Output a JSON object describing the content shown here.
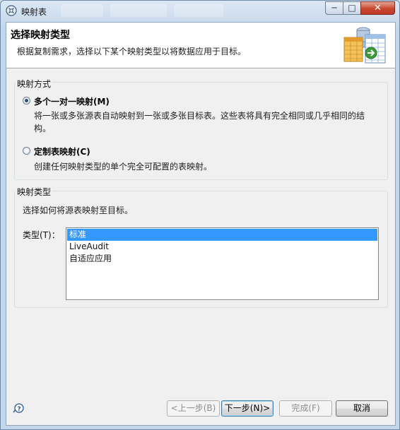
{
  "window": {
    "title": "映射表",
    "minimize_glyph": "─",
    "maximize_glyph": "□",
    "close_glyph": "✕"
  },
  "header": {
    "title": "选择映射类型",
    "description": "根据复制需求，选择以下某个映射类型以将数据应用于目标。"
  },
  "mapping_method": {
    "legend": "映射方式",
    "options": [
      {
        "label": "多个一对一映射(M)",
        "description": "将一张或多张源表自动映射到一张或多张目标表。这些表将具有完全相同或几乎相同的结构。",
        "selected": true
      },
      {
        "label": "定制表映射(C)",
        "description": "创建任何映射类型的单个完全可配置的表映射。",
        "selected": false
      }
    ]
  },
  "mapping_type": {
    "legend": "映射类型",
    "instruction": "选择如何将源表映射至目标。",
    "type_label": "类型(T)：",
    "items": [
      "标准",
      "LiveAudit",
      "自适应应用"
    ],
    "selected_index": 0
  },
  "buttons": {
    "back": "<上一步(B)",
    "next": "下一步(N)>",
    "finish": "完成(F)",
    "cancel": "取消"
  },
  "colors": {
    "selection": "#3399ff",
    "dialog_bg": "#f0f0f0"
  }
}
